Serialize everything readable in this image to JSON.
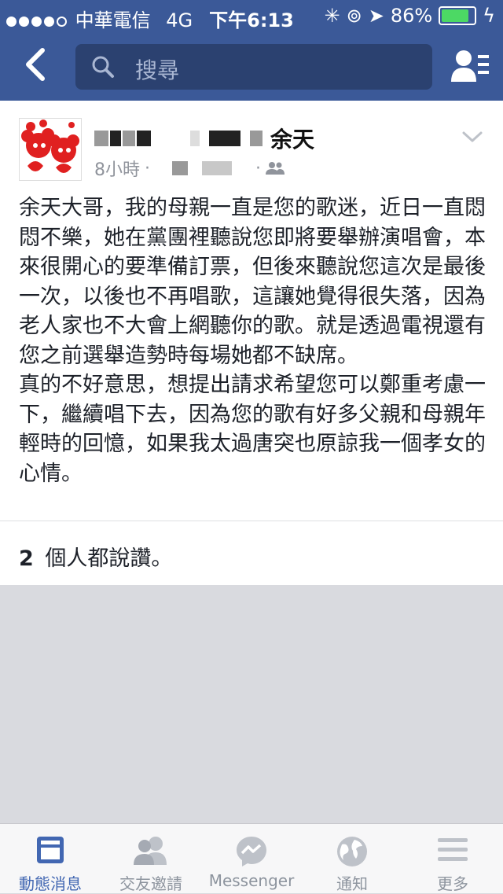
{
  "status_bar": {
    "carrier": "中華電信",
    "network": "4G",
    "time": "下午6:13",
    "battery": "86%"
  },
  "nav": {
    "search_placeholder": "搜尋"
  },
  "post": {
    "author_name": "余天",
    "time": "8小時",
    "separator": "·",
    "body": "余天大哥，我的母親一直是您的歌迷，近日一直悶悶不樂，她在黨團裡聽說您即將要舉辦演唱會，本來很開心的要準備訂票，但後來聽說您這次是最後一次，以後也不再唱歌，這讓她覺得很失落，因為老人家也不大會上網聽你的歌。就是透過電視還有您之前選舉造勢時每場她都不缺席。\n真的不好意思，想提出請求希望您可以鄭重考慮一下，繼續唱下去，因為您的歌有好多父親和母親年輕時的回憶，如果我太過唐突也原諒我一個孝女的心情。",
    "likes_count": "2",
    "likes_text": "個人都說讚。"
  },
  "tabs": [
    {
      "label": "動態消息",
      "icon": "news-feed-icon",
      "active": true
    },
    {
      "label": "交友邀請",
      "icon": "friend-requests-icon",
      "active": false
    },
    {
      "label": "Messenger",
      "icon": "messenger-icon",
      "active": false
    },
    {
      "label": "通知",
      "icon": "globe-icon",
      "active": false
    },
    {
      "label": "更多",
      "icon": "menu-icon",
      "active": false
    }
  ],
  "colors": {
    "brand": "#3b5998",
    "active_tab": "#4267b2",
    "battery": "#4cd964"
  }
}
